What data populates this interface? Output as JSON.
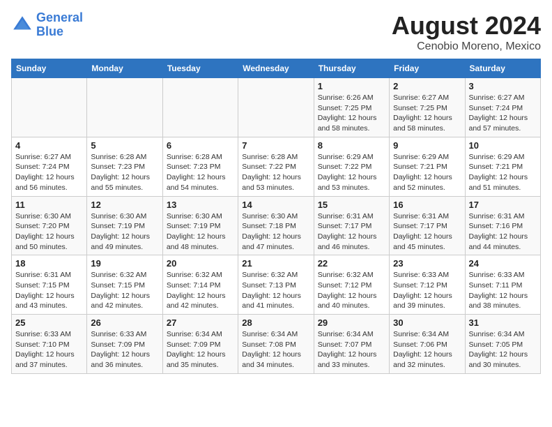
{
  "header": {
    "logo_line1": "General",
    "logo_line2": "Blue",
    "title": "August 2024",
    "subtitle": "Cenobio Moreno, Mexico"
  },
  "days_of_week": [
    "Sunday",
    "Monday",
    "Tuesday",
    "Wednesday",
    "Thursday",
    "Friday",
    "Saturday"
  ],
  "weeks": [
    [
      {
        "day": "",
        "info": ""
      },
      {
        "day": "",
        "info": ""
      },
      {
        "day": "",
        "info": ""
      },
      {
        "day": "",
        "info": ""
      },
      {
        "day": "1",
        "info": "Sunrise: 6:26 AM\nSunset: 7:25 PM\nDaylight: 12 hours\nand 58 minutes."
      },
      {
        "day": "2",
        "info": "Sunrise: 6:27 AM\nSunset: 7:25 PM\nDaylight: 12 hours\nand 58 minutes."
      },
      {
        "day": "3",
        "info": "Sunrise: 6:27 AM\nSunset: 7:24 PM\nDaylight: 12 hours\nand 57 minutes."
      }
    ],
    [
      {
        "day": "4",
        "info": "Sunrise: 6:27 AM\nSunset: 7:24 PM\nDaylight: 12 hours\nand 56 minutes."
      },
      {
        "day": "5",
        "info": "Sunrise: 6:28 AM\nSunset: 7:23 PM\nDaylight: 12 hours\nand 55 minutes."
      },
      {
        "day": "6",
        "info": "Sunrise: 6:28 AM\nSunset: 7:23 PM\nDaylight: 12 hours\nand 54 minutes."
      },
      {
        "day": "7",
        "info": "Sunrise: 6:28 AM\nSunset: 7:22 PM\nDaylight: 12 hours\nand 53 minutes."
      },
      {
        "day": "8",
        "info": "Sunrise: 6:29 AM\nSunset: 7:22 PM\nDaylight: 12 hours\nand 53 minutes."
      },
      {
        "day": "9",
        "info": "Sunrise: 6:29 AM\nSunset: 7:21 PM\nDaylight: 12 hours\nand 52 minutes."
      },
      {
        "day": "10",
        "info": "Sunrise: 6:29 AM\nSunset: 7:21 PM\nDaylight: 12 hours\nand 51 minutes."
      }
    ],
    [
      {
        "day": "11",
        "info": "Sunrise: 6:30 AM\nSunset: 7:20 PM\nDaylight: 12 hours\nand 50 minutes."
      },
      {
        "day": "12",
        "info": "Sunrise: 6:30 AM\nSunset: 7:19 PM\nDaylight: 12 hours\nand 49 minutes."
      },
      {
        "day": "13",
        "info": "Sunrise: 6:30 AM\nSunset: 7:19 PM\nDaylight: 12 hours\nand 48 minutes."
      },
      {
        "day": "14",
        "info": "Sunrise: 6:30 AM\nSunset: 7:18 PM\nDaylight: 12 hours\nand 47 minutes."
      },
      {
        "day": "15",
        "info": "Sunrise: 6:31 AM\nSunset: 7:17 PM\nDaylight: 12 hours\nand 46 minutes."
      },
      {
        "day": "16",
        "info": "Sunrise: 6:31 AM\nSunset: 7:17 PM\nDaylight: 12 hours\nand 45 minutes."
      },
      {
        "day": "17",
        "info": "Sunrise: 6:31 AM\nSunset: 7:16 PM\nDaylight: 12 hours\nand 44 minutes."
      }
    ],
    [
      {
        "day": "18",
        "info": "Sunrise: 6:31 AM\nSunset: 7:15 PM\nDaylight: 12 hours\nand 43 minutes."
      },
      {
        "day": "19",
        "info": "Sunrise: 6:32 AM\nSunset: 7:15 PM\nDaylight: 12 hours\nand 42 minutes."
      },
      {
        "day": "20",
        "info": "Sunrise: 6:32 AM\nSunset: 7:14 PM\nDaylight: 12 hours\nand 42 minutes."
      },
      {
        "day": "21",
        "info": "Sunrise: 6:32 AM\nSunset: 7:13 PM\nDaylight: 12 hours\nand 41 minutes."
      },
      {
        "day": "22",
        "info": "Sunrise: 6:32 AM\nSunset: 7:12 PM\nDaylight: 12 hours\nand 40 minutes."
      },
      {
        "day": "23",
        "info": "Sunrise: 6:33 AM\nSunset: 7:12 PM\nDaylight: 12 hours\nand 39 minutes."
      },
      {
        "day": "24",
        "info": "Sunrise: 6:33 AM\nSunset: 7:11 PM\nDaylight: 12 hours\nand 38 minutes."
      }
    ],
    [
      {
        "day": "25",
        "info": "Sunrise: 6:33 AM\nSunset: 7:10 PM\nDaylight: 12 hours\nand 37 minutes."
      },
      {
        "day": "26",
        "info": "Sunrise: 6:33 AM\nSunset: 7:09 PM\nDaylight: 12 hours\nand 36 minutes."
      },
      {
        "day": "27",
        "info": "Sunrise: 6:34 AM\nSunset: 7:09 PM\nDaylight: 12 hours\nand 35 minutes."
      },
      {
        "day": "28",
        "info": "Sunrise: 6:34 AM\nSunset: 7:08 PM\nDaylight: 12 hours\nand 34 minutes."
      },
      {
        "day": "29",
        "info": "Sunrise: 6:34 AM\nSunset: 7:07 PM\nDaylight: 12 hours\nand 33 minutes."
      },
      {
        "day": "30",
        "info": "Sunrise: 6:34 AM\nSunset: 7:06 PM\nDaylight: 12 hours\nand 32 minutes."
      },
      {
        "day": "31",
        "info": "Sunrise: 6:34 AM\nSunset: 7:05 PM\nDaylight: 12 hours\nand 30 minutes."
      }
    ]
  ]
}
